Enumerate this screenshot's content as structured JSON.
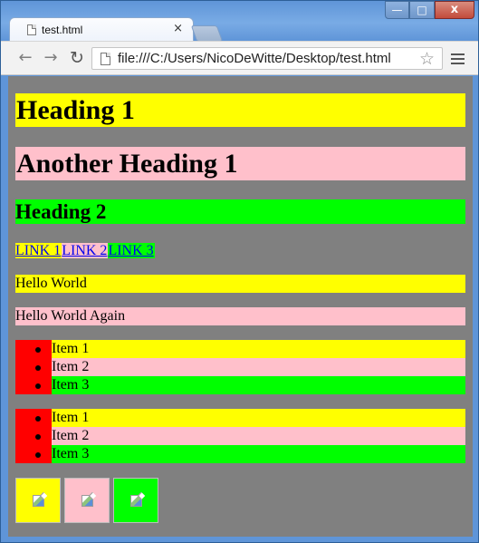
{
  "browser": {
    "tab_title": "test.html",
    "tab_close": "×",
    "address": "file:///C:/Users/NicoDeWitte/Desktop/test.html",
    "icons": {
      "back": "back-arrow-icon",
      "forward": "forward-arrow-icon",
      "reload": "reload-icon",
      "star": "star-icon",
      "menu": "menu-icon",
      "page": "page-icon"
    },
    "window_controls": {
      "minimize": "—",
      "maximize": "□",
      "close": "x"
    }
  },
  "page": {
    "headings": [
      {
        "label": "Heading 1",
        "color": "#ffff00"
      },
      {
        "label": "Another Heading 1",
        "color": "#ffc0cb"
      }
    ],
    "heading2": {
      "label": "Heading 2",
      "color": "#00ff00"
    },
    "links": [
      {
        "label": "LINK 1",
        "color": "#ffff00"
      },
      {
        "label": "LINK 2",
        "color": "#ffc0cb"
      },
      {
        "label": "LINK 3",
        "color": "#00ff00"
      }
    ],
    "paragraphs": [
      {
        "text": "Hello World",
        "color": "#ffff00"
      },
      {
        "text": "Hello World Again",
        "color": "#ffc0cb"
      }
    ],
    "lists": [
      {
        "items": [
          "Item 1",
          "Item 2",
          "Item 3"
        ],
        "bullet_background": "#ff0000"
      },
      {
        "items": [
          "Item 1",
          "Item 2",
          "Item 3"
        ],
        "bullet_background": "#ff0000"
      }
    ],
    "images": [
      {
        "icon": "broken-image-icon",
        "color": "#ffff00"
      },
      {
        "icon": "broken-image-icon",
        "color": "#ffc0cb"
      },
      {
        "icon": "broken-image-icon",
        "color": "#00ff00"
      }
    ],
    "background": "#808080"
  }
}
